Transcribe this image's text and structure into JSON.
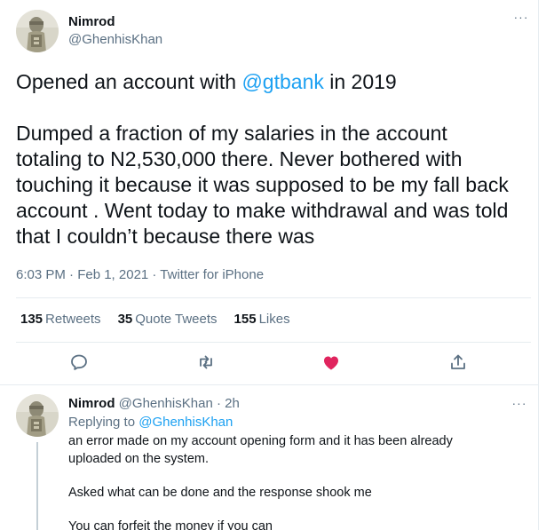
{
  "main_tweet": {
    "author": {
      "display_name": "Nimrod",
      "handle": "@GhenhisKhan"
    },
    "text": {
      "line1_prefix": "Opened an account with ",
      "line1_mention": "@gtbank",
      "line1_suffix": " in 2019",
      "line2": "Dumped a fraction of my salaries in the account",
      "line3": "totaling to N2,530,000 there. Never bothered with",
      "line4": "touching it because it was supposed to be my fall back",
      "line5": "account . Went today to make withdrawal and was told",
      "line6": "that I couldn’t because there was"
    },
    "meta": "6:03 PM · Feb 1, 2021 · Twitter for iPhone",
    "stats": {
      "retweets_count": "135",
      "retweets_label": "Retweets",
      "quote_count": "35",
      "quote_label": "Quote Tweets",
      "likes_count": "155",
      "likes_label": "Likes"
    },
    "more_glyph": "···"
  },
  "reply": {
    "author": {
      "display_name": "Nimrod",
      "handle": "@GhenhisKhan"
    },
    "dot": "·",
    "time": "2h",
    "replying_prefix": "Replying to ",
    "replying_mention": "@GhenhisKhan",
    "body": {
      "line1": "an error made on my account opening form and it has been already",
      "line2": "uploaded on the system.",
      "line3": "Asked what can be done and the response shook me",
      "line4": "You can forfeit the money if you can"
    },
    "more_glyph": "···"
  },
  "icons": {
    "reply": "reply-bubble-icon",
    "retweet": "retweet-icon",
    "like": "heart-icon",
    "share": "share-icon",
    "more": "more-dots-icon"
  },
  "colors": {
    "accent": "#1da1f2",
    "like": "#e0245e",
    "muted": "#5b7083",
    "border": "#e6ecf0"
  }
}
